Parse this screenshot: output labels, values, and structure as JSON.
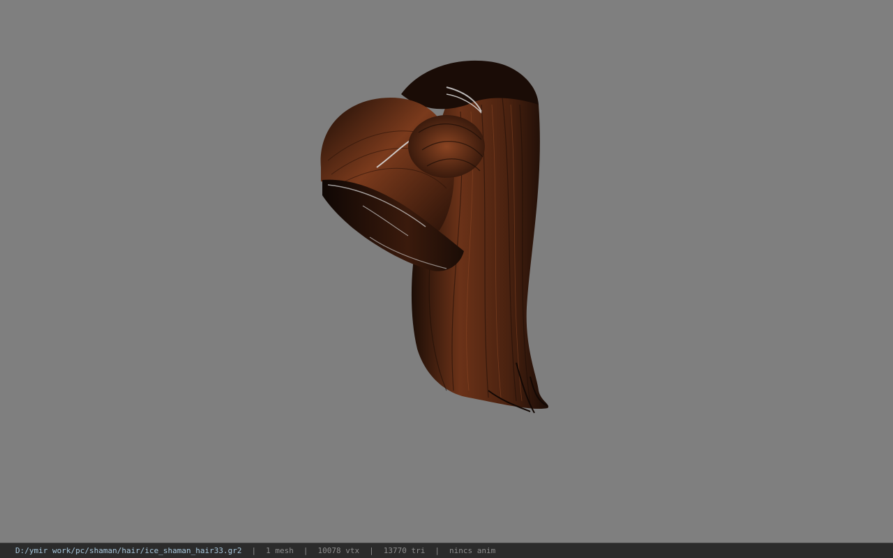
{
  "viewport": {
    "background_color": "#7f7f7f",
    "model": {
      "kind": "3d-hair-mesh",
      "colors": {
        "hair_dark": "#1a0c06",
        "hair_mid": "#5a2a12",
        "hair_light": "#8a4422",
        "highlight": "#d8d8d8"
      }
    }
  },
  "status_bar": {
    "file_path": "D:/ymir work/pc/shaman/hair/ice_shaman_hair33.gr2",
    "separator": "|",
    "mesh_count": "1 mesh",
    "vertex_count": "10078 vtx",
    "triangle_count": "13770 tri",
    "animation": "nincs anim"
  }
}
